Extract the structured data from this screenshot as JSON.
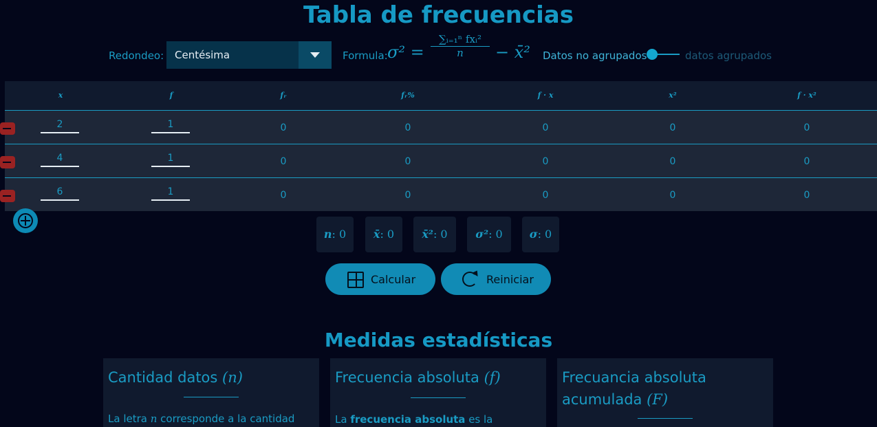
{
  "title": "Tabla de frecuencias",
  "controls": {
    "rounding_label": "Redondeo:",
    "rounding_value": "Centésima",
    "formula_label": "Formula:",
    "formula_lhs": "σ² =",
    "formula_numerator": "∑ᵢ₌₁ⁿ fxᵢ²",
    "formula_denominator": "n",
    "formula_tail": "− x̄²",
    "toggle_left": "Datos no agrupados",
    "toggle_right": "datos agrupados"
  },
  "table": {
    "headers": [
      "x",
      "f",
      "fᵣ",
      "fᵣ%",
      "f · x",
      "x²",
      "f · x²"
    ],
    "rows": [
      {
        "x": "2",
        "f": "1",
        "fr": "0",
        "frp": "0",
        "fx": "0",
        "x2": "0",
        "fx2": "0"
      },
      {
        "x": "4",
        "f": "1",
        "fr": "0",
        "frp": "0",
        "fx": "0",
        "x2": "0",
        "fx2": "0"
      },
      {
        "x": "6",
        "f": "1",
        "fr": "0",
        "frp": "0",
        "fx": "0",
        "x2": "0",
        "fx2": "0"
      }
    ]
  },
  "stats": {
    "n_label": "n",
    "n_value": ": 0",
    "mean_label": "x̄",
    "mean_value": ": 0",
    "mean2_label": "x̄²",
    "mean2_value": ": 0",
    "var_label": "σ²",
    "var_value": ": 0",
    "std_label": "σ",
    "std_value": ": 0"
  },
  "actions": {
    "calc": "Calcular",
    "reset": "Reiniciar"
  },
  "section_title": "Medidas estadísticas",
  "cards": [
    {
      "title": "Cantidad datos ",
      "symbol": "(n)",
      "body_pre": "La letra ",
      "body_sym": "n",
      "body_post": " corresponde a la cantidad"
    },
    {
      "title": "Frecuencia absoluta ",
      "symbol": "(f)",
      "body_pre": "La ",
      "body_bold": "frecuencia absoluta",
      "body_post": " es la"
    },
    {
      "title_line1": "Frecuancia absoluta",
      "title_line2": "acumulada ",
      "symbol": "(F)"
    }
  ],
  "colors": {
    "background": "#03061a",
    "accent": "#1699c4",
    "row": "#1e2738",
    "delete": "#9a2222"
  }
}
